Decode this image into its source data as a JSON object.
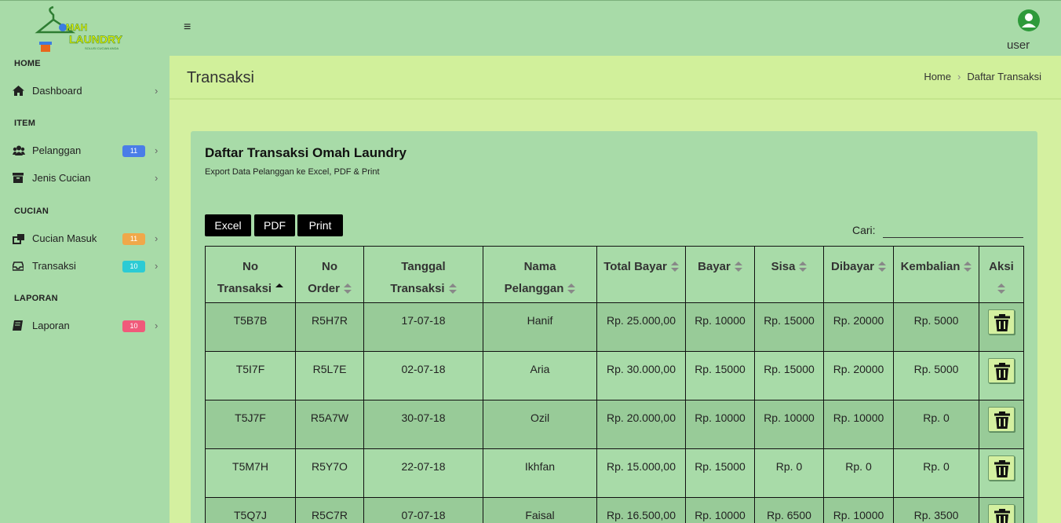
{
  "header": {
    "logo_text": "OMAH LAUNDRY",
    "logo_tagline": "SOLUSI CUCIAN ANDA",
    "menu_icon": "hamburger-icon",
    "user_label": "user"
  },
  "sidebar": {
    "sections": [
      {
        "title": "HOME"
      },
      {
        "title": "ITEM"
      },
      {
        "title": "CUCIAN"
      },
      {
        "title": "LAPORAN"
      }
    ],
    "items": [
      {
        "label": "Dashboard",
        "icon": "home-icon",
        "badge": ""
      },
      {
        "label": "Pelanggan",
        "icon": "users-icon",
        "badge": "11",
        "badge_color": "#4a7de8"
      },
      {
        "label": "Jenis Cucian",
        "icon": "archive-icon",
        "badge": ""
      },
      {
        "label": "Cucian Masuk",
        "icon": "external-link-icon",
        "badge": "11",
        "badge_color": "#f0a84a"
      },
      {
        "label": "Transaksi",
        "icon": "inbox-icon",
        "badge": "10",
        "badge_color": "#2ccbd4"
      },
      {
        "label": "Laporan",
        "icon": "book-icon",
        "badge": "10",
        "badge_color": "#f05a7a"
      }
    ]
  },
  "content": {
    "page_title": "Transaksi",
    "breadcrumb": {
      "home": "Home",
      "current": "Daftar Transaksi"
    }
  },
  "card": {
    "title": "Daftar Transaksi Omah Laundry",
    "subtitle": "Export Data Pelanggan ke Excel, PDF & Print",
    "buttons": {
      "excel": "Excel",
      "pdf": "PDF",
      "print": "Print"
    },
    "search_label": "Cari:",
    "search_value": ""
  },
  "table": {
    "headers": [
      {
        "line1": "No",
        "line2": "Transaksi"
      },
      {
        "line1": "No",
        "line2": "Order"
      },
      {
        "line1": "Tanggal",
        "line2": "Transaksi"
      },
      {
        "line1": "Nama",
        "line2": "Pelanggan"
      },
      {
        "line1": "Total Bayar",
        "line2": ""
      },
      {
        "line1": "Bayar",
        "line2": ""
      },
      {
        "line1": "Sisa",
        "line2": ""
      },
      {
        "line1": "Dibayar",
        "line2": ""
      },
      {
        "line1": "Kembalian",
        "line2": ""
      },
      {
        "line1": "Aksi",
        "line2": ""
      }
    ],
    "rows": [
      [
        "T5B7B",
        "R5H7R",
        "17-07-18",
        "Hanif",
        "Rp. 25.000,00",
        "Rp. 10000",
        "Rp. 15000",
        "Rp. 20000",
        "Rp. 5000"
      ],
      [
        "T5I7F",
        "R5L7E",
        "02-07-18",
        "Aria",
        "Rp. 30.000,00",
        "Rp. 15000",
        "Rp. 15000",
        "Rp. 20000",
        "Rp. 5000"
      ],
      [
        "T5J7F",
        "R5A7W",
        "30-07-18",
        "Ozil",
        "Rp. 20.000,00",
        "Rp. 10000",
        "Rp. 10000",
        "Rp. 10000",
        "Rp. 0"
      ],
      [
        "T5M7H",
        "R5Y7O",
        "22-07-18",
        "Ikhfan",
        "Rp. 15.000,00",
        "Rp. 15000",
        "Rp. 0",
        "Rp. 0",
        "Rp. 0"
      ],
      [
        "T5Q7J",
        "R5C7R",
        "07-07-18",
        "Faisal",
        "Rp. 16.500,00",
        "Rp. 10000",
        "Rp. 6500",
        "Rp. 10000",
        "Rp. 3500"
      ]
    ],
    "action_icon": "trash-icon"
  }
}
